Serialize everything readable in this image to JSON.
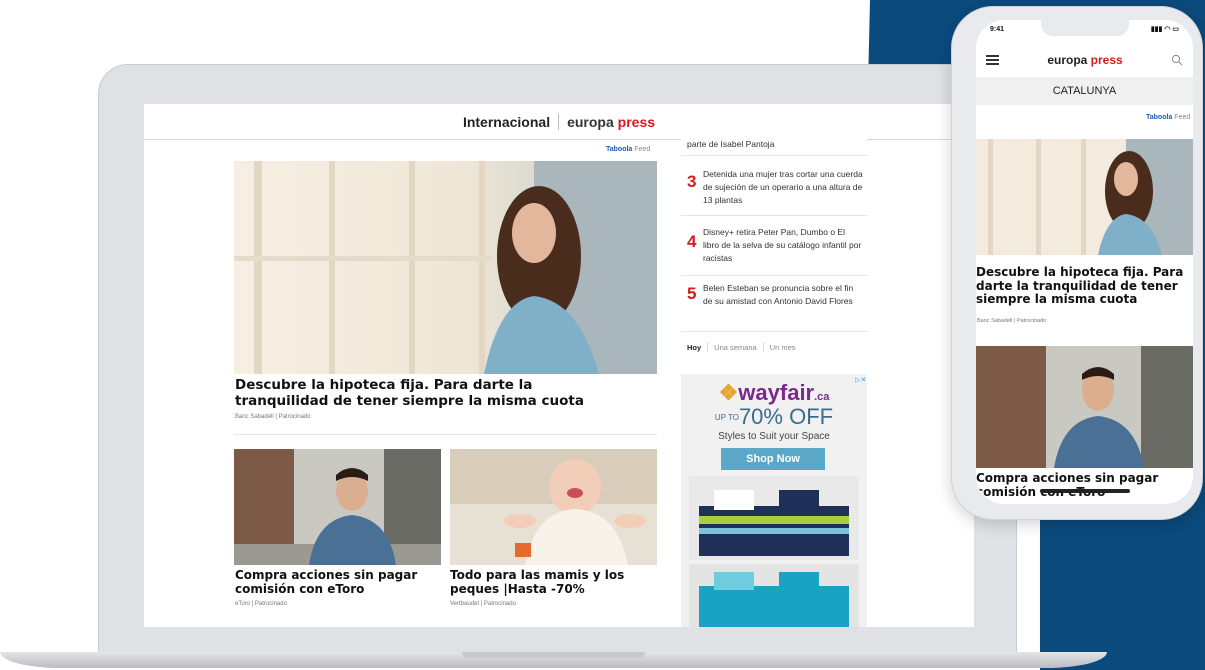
{
  "laptop": {
    "header": {
      "section": "Internacional",
      "brand_left": "europa ",
      "brand_right": "press"
    },
    "taboola": {
      "brand": "Taboola",
      "feed": "Feed"
    },
    "hero": {
      "title": "Descubre la hipoteca fija. Para darte la tranquilidad de tener siempre la misma cuota",
      "source": "Banc Sabadell | Patrocinado"
    },
    "cards": [
      {
        "title": "Compra acciones sin pagar comisión con eToro",
        "source": "eToro | Patrocinado"
      },
      {
        "title": "Todo para las mamis y los peques |Hasta -70%",
        "source": "Vertbaudet | Patrocinado"
      }
    ],
    "ranking": {
      "items": [
        {
          "num": "",
          "text": "parte de Isabel Pantoja"
        },
        {
          "num": "3",
          "text": "Detenida una mujer tras cortar una cuerda de sujeción de un operario a una altura de 13 plantas"
        },
        {
          "num": "4",
          "text": "Disney+ retira Peter Pan, Dumbo o El libro de la selva de su catálogo infantil por racistas"
        },
        {
          "num": "5",
          "text": "Belen Esteban se pronuncia sobre el fin de su amistad con Antonio David Flores"
        }
      ],
      "tabs": [
        "Hoy",
        "Una semana",
        "Un mes"
      ]
    },
    "ad": {
      "logo": "wayfair",
      "logo_suffix": ".ca",
      "upto": "UP TO",
      "offer": "70% OFF",
      "subtitle": "Styles to Suit your Space",
      "button": "Shop Now"
    }
  },
  "phone": {
    "time": "9:41",
    "brand_left": "europa ",
    "brand_right": "press",
    "section": "CATALUNYA",
    "taboola": "Taboola",
    "taboola_feed": "Feed",
    "hero_title": "Descubre la hipoteca fija. Para darte la tranquilidad de tener siempre la misma cuota",
    "hero_source": "Banc Sabadell | Patrocinado",
    "card_title": "Compra acciones sin pagar comisión con eToro"
  },
  "colors": {
    "brand_red": "#d71920",
    "background_blue": "#0b4a7c",
    "ad_purple": "#7b2a8c"
  }
}
